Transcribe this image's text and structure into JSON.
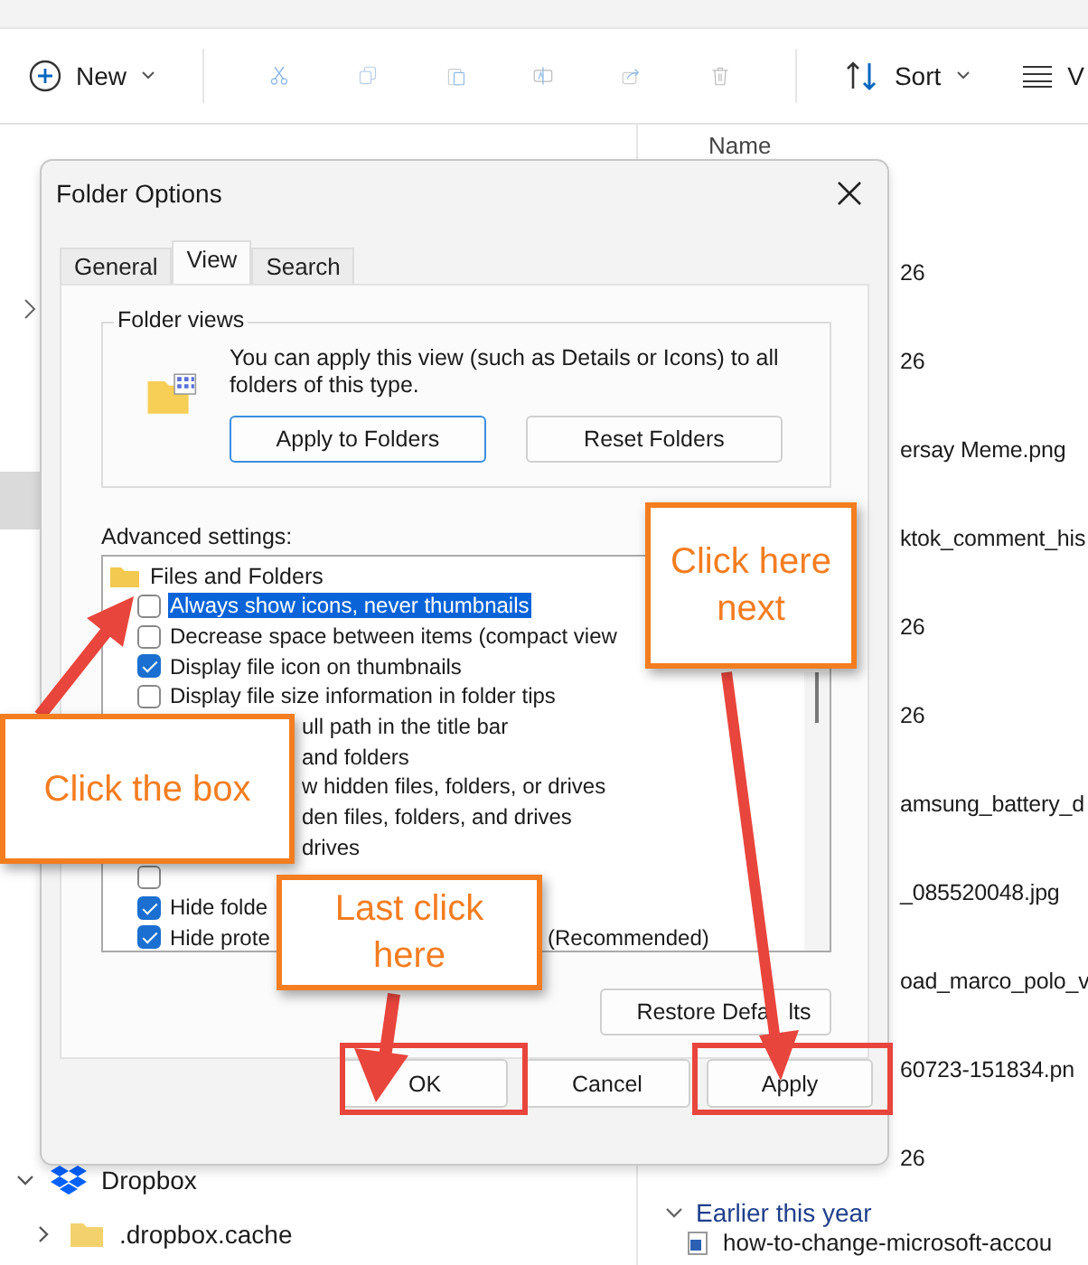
{
  "explorer": {
    "toolbar": {
      "new_label": "New",
      "sort_label": "Sort",
      "view_label": "V"
    },
    "nav": [
      {
        "label": "Dropbox",
        "expanded": true,
        "kind": "dropbox"
      },
      {
        "label": ".dropbox.cache",
        "expanded": false,
        "kind": "folder"
      }
    ],
    "list_header": "Name",
    "files": [
      "26",
      "26",
      "ersay Meme.png",
      "ktok_comment_his",
      "26",
      "26",
      "amsung_battery_d",
      "_085520048.jpg",
      "oad_marco_polo_v",
      "60723-151834.pn",
      "26"
    ],
    "group": {
      "label": "Earlier this year",
      "expanded": true
    },
    "last_file": "how-to-change-microsoft-accou"
  },
  "dialog": {
    "title": "Folder Options",
    "tabs": [
      {
        "label": "General",
        "selected": false
      },
      {
        "label": "View",
        "selected": true
      },
      {
        "label": "Search",
        "selected": false
      }
    ],
    "folder_views": {
      "legend": "Folder views",
      "text": "You can apply this view (such as Details or Icons) to all folders of this type.",
      "buttons": [
        "Apply to Folders",
        "Reset Folders"
      ]
    },
    "advanced_label": "Advanced settings:",
    "tree": {
      "label": "Files and Folders",
      "items": [
        {
          "kind": "full",
          "text": "Always show icons, never thumbnails",
          "checked": false,
          "selected": true
        },
        {
          "kind": "full",
          "text": "Decrease space between items (compact view",
          "checked": false,
          "selected": false
        },
        {
          "kind": "full",
          "text": "Display file icon on thumbnails",
          "checked": true,
          "selected": false
        },
        {
          "kind": "full",
          "text": "Display file size information in folder tips",
          "checked": false,
          "selected": false
        },
        {
          "kind": "partial",
          "text": "ull path in the title bar",
          "selected": false
        },
        {
          "kind": "partial",
          "text": "and folders",
          "selected": false
        },
        {
          "kind": "partial",
          "text": "w hidden files, folders, or drives",
          "selected": false
        },
        {
          "kind": "partial",
          "text": "den files, folders, and drives",
          "selected": false
        },
        {
          "kind": "partial",
          "text": "drives",
          "selected": false
        },
        {
          "kind": "box_only",
          "checked": false,
          "selected": false
        },
        {
          "kind": "full",
          "text": "Hide folde",
          "checked": true,
          "selected": false
        },
        {
          "kind": "split",
          "text": "Hide prote",
          "tail": "(Recommended)",
          "checked": true,
          "selected": false
        }
      ]
    },
    "restore_button": "Restore Defa   lts",
    "buttons": [
      "OK",
      "Cancel",
      "Apply"
    ]
  },
  "callouts": [
    {
      "text": "Click here next",
      "kind": "next"
    },
    {
      "text": "Click the box",
      "kind": "box"
    },
    {
      "text": "Last click here",
      "kind": "last"
    }
  ]
}
